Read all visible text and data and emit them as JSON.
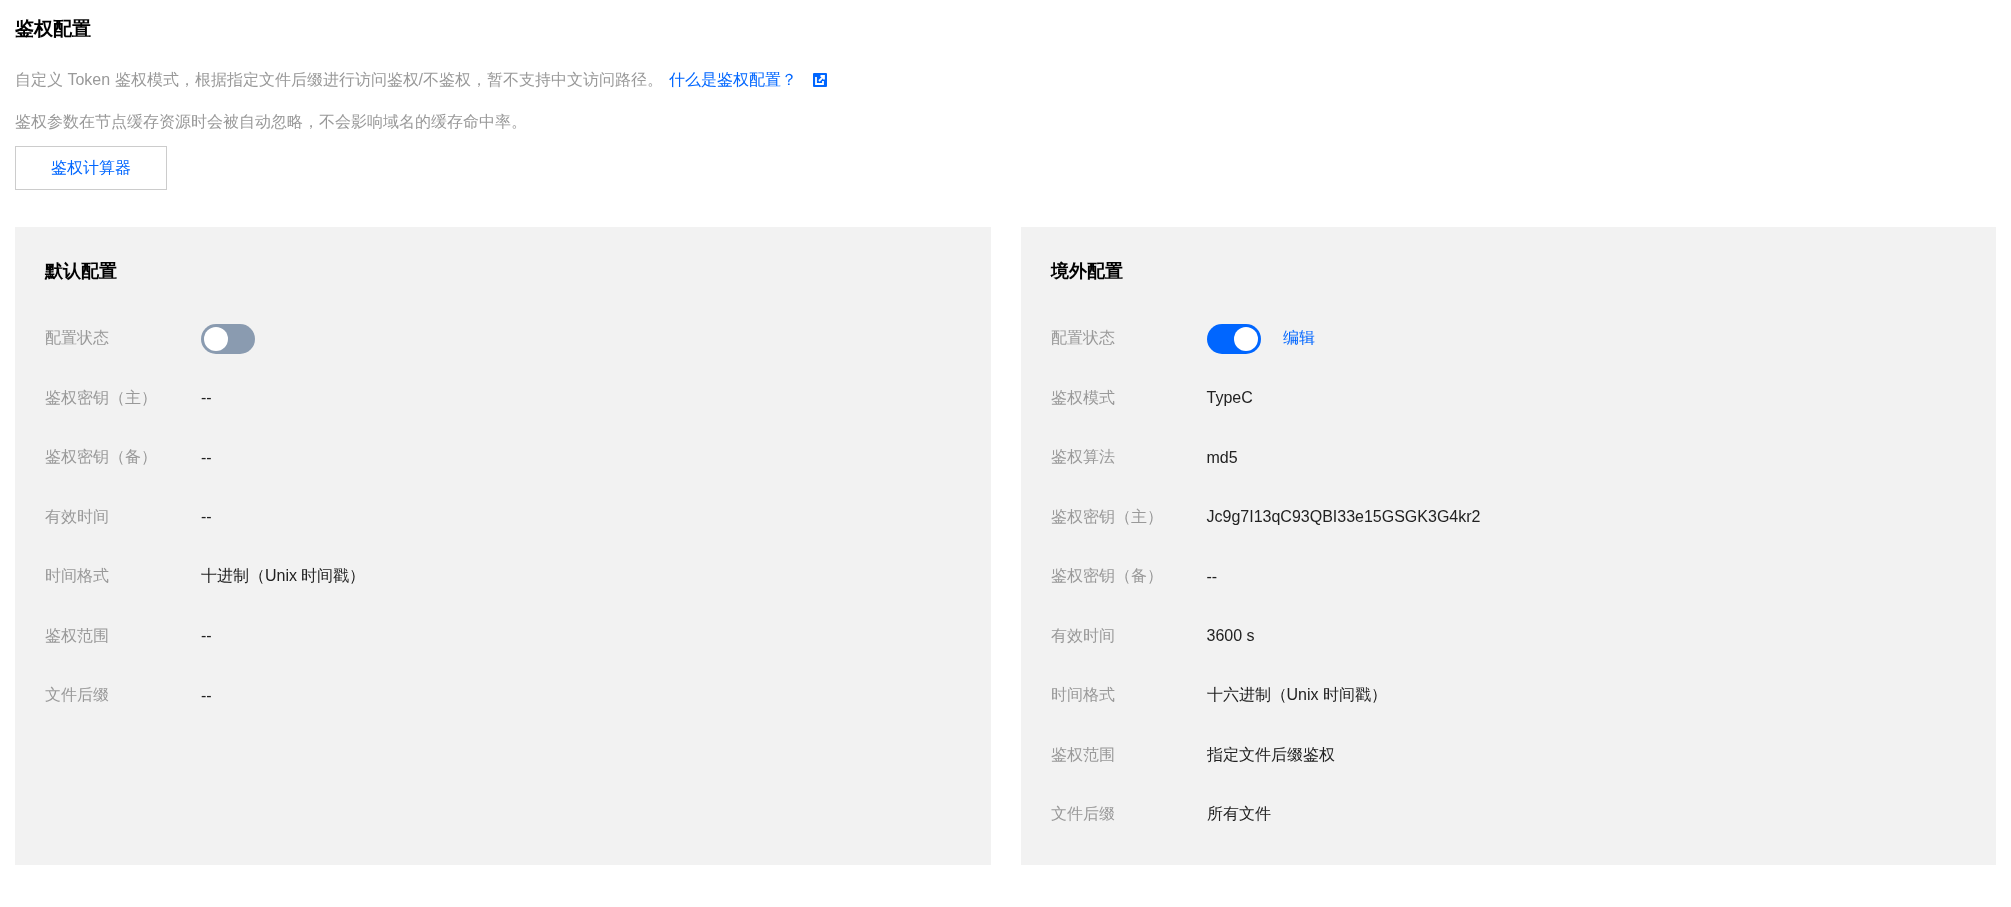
{
  "title": "鉴权配置",
  "description": {
    "text": "自定义 Token 鉴权模式，根据指定文件后缀进行访问鉴权/不鉴权，暂不支持中文访问路径。",
    "link": "什么是鉴权配置？"
  },
  "note": "鉴权参数在节点缓存资源时会被自动忽略，不会影响域名的缓存命中率。",
  "calculator_button": "鉴权计算器",
  "panels": [
    {
      "title": "默认配置",
      "rows": [
        {
          "kind": "switch",
          "label": "配置状态",
          "on": false
        },
        {
          "kind": "text",
          "label": "鉴权密钥（主）",
          "value": "--"
        },
        {
          "kind": "text",
          "label": "鉴权密钥（备）",
          "value": "--"
        },
        {
          "kind": "text",
          "label": "有效时间",
          "value": "--"
        },
        {
          "kind": "text",
          "label": "时间格式",
          "value": "十进制（Unix 时间戳）"
        },
        {
          "kind": "text",
          "label": "鉴权范围",
          "value": "--"
        },
        {
          "kind": "text",
          "label": "文件后缀",
          "value": "--"
        }
      ]
    },
    {
      "title": "境外配置",
      "rows": [
        {
          "kind": "switch",
          "label": "配置状态",
          "on": true,
          "action": "编辑"
        },
        {
          "kind": "text",
          "label": "鉴权模式",
          "value": "TypeC"
        },
        {
          "kind": "text",
          "label": "鉴权算法",
          "value": "md5"
        },
        {
          "kind": "text",
          "label": "鉴权密钥（主）",
          "value": "Jc9g7I13qC93QBI33e15GSGK3G4kr2"
        },
        {
          "kind": "text",
          "label": "鉴权密钥（备）",
          "value": "--"
        },
        {
          "kind": "text",
          "label": "有效时间",
          "value": "3600 s"
        },
        {
          "kind": "text",
          "label": "时间格式",
          "value": "十六进制（Unix 时间戳）"
        },
        {
          "kind": "text",
          "label": "鉴权范围",
          "value": "指定文件后缀鉴权"
        },
        {
          "kind": "text",
          "label": "文件后缀",
          "value": "所有文件"
        }
      ]
    }
  ]
}
